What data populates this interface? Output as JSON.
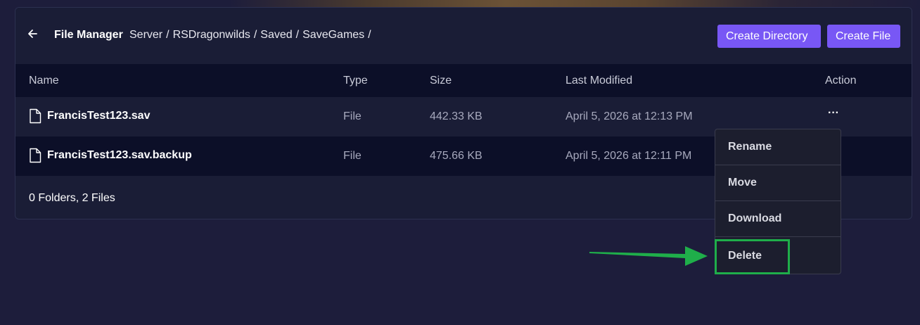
{
  "header": {
    "title": "File Manager",
    "breadcrumb": [
      "Server",
      "RSDragonwilds",
      "Saved",
      "SaveGames"
    ],
    "separator": "/",
    "create_directory_label": "Create Directory",
    "create_file_label": "Create File"
  },
  "table": {
    "columns": [
      "Name",
      "Type",
      "Size",
      "Last Modified",
      "Action"
    ],
    "rows": [
      {
        "name": "FrancisTest123.sav",
        "type": "File",
        "size": "442.33 KB",
        "modified": "April 5, 2026 at 12:13 PM",
        "action": "···"
      },
      {
        "name": "FrancisTest123.sav.backup",
        "type": "File",
        "size": "475.66 KB",
        "modified": "April 5, 2026 at 12:11 PM",
        "action": ""
      }
    ],
    "summary": "0 Folders, 2 Files"
  },
  "context_menu": {
    "items": [
      "Rename",
      "Move",
      "Download",
      "Delete"
    ]
  },
  "colors": {
    "accent": "#7857f5",
    "highlight": "#1fae4a",
    "background": "#1d1d3b",
    "panel": "#1a1d36",
    "table_header": "#0c0f28"
  }
}
